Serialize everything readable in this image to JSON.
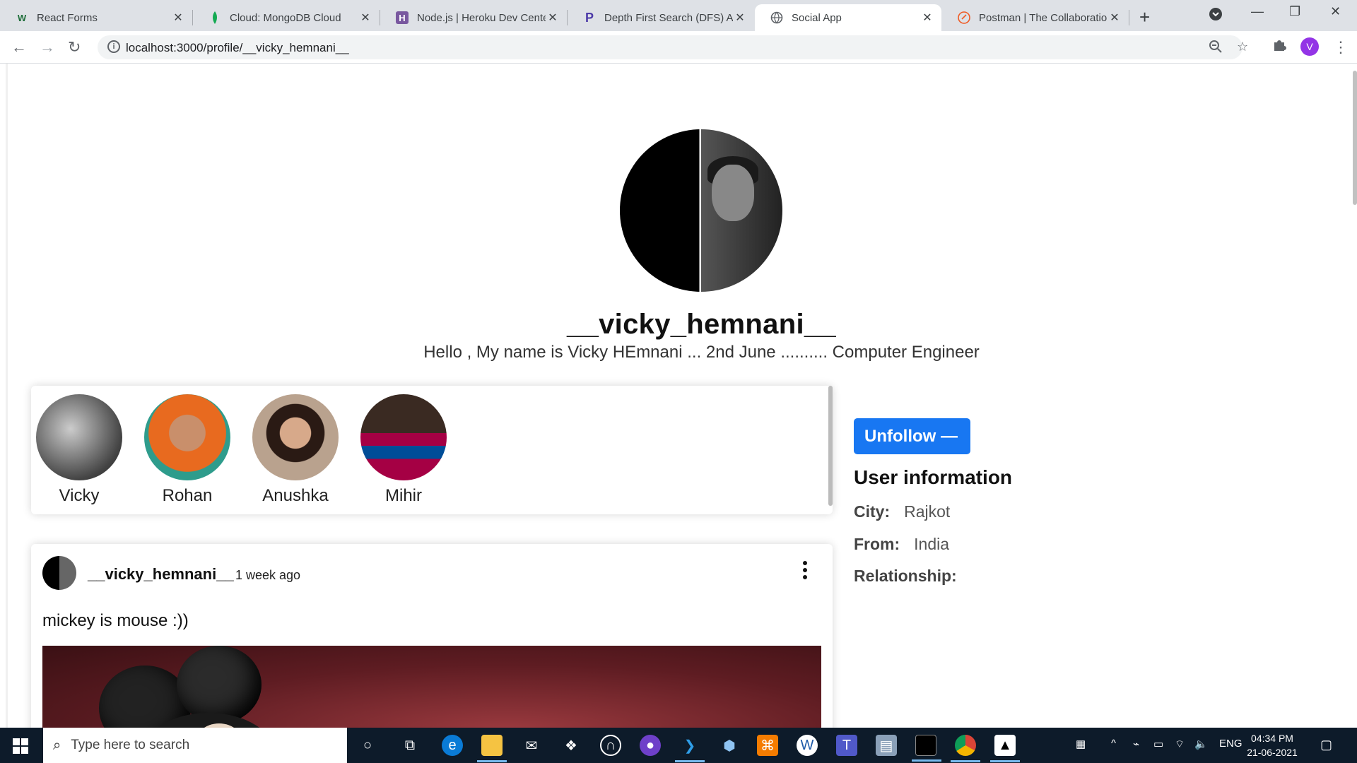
{
  "browser": {
    "tabs": [
      {
        "title": "React Forms",
        "icon": "wix-icon",
        "color": "#1e6e3a"
      },
      {
        "title": "Cloud: MongoDB Cloud",
        "icon": "mongodb-leaf-icon",
        "color": "#13aa52"
      },
      {
        "title": "Node.js | Heroku Dev Cente",
        "icon": "heroku-icon",
        "color": "#79589f"
      },
      {
        "title": "Depth First Search (DFS) Alg",
        "icon": "programiz-icon",
        "color": "#4c3aa8"
      },
      {
        "title": "Social App",
        "icon": "globe-icon",
        "color": "#5f6368"
      },
      {
        "title": "Postman | The Collaboration",
        "icon": "postman-icon",
        "color": "#ef5b25"
      }
    ],
    "active_tab_index": 4,
    "url": "localhost:3000/profile/__vicky_hemnani__",
    "profile_initial": "V"
  },
  "profile": {
    "username": "__vicky_hemnani__",
    "bio": "Hello , My name is Vicky HEmnani ... 2nd June .......... Computer Engineer"
  },
  "friends": [
    {
      "name": "Vicky"
    },
    {
      "name": "Rohan"
    },
    {
      "name": "Anushka"
    },
    {
      "name": "Mihir"
    }
  ],
  "post": {
    "username": "__vicky_hemnani__",
    "time": "1 week ago",
    "text": "mickey is mouse :))"
  },
  "sidebar": {
    "unfollow_label": "Unfollow —",
    "title": "User information",
    "city_label": "City:",
    "city_value": "Rajkot",
    "from_label": "From:",
    "from_value": "India",
    "relationship_label": "Relationship:",
    "relationship_value": ""
  },
  "taskbar": {
    "search_placeholder": "Type here to search",
    "language": "ENG",
    "time": "04:34 PM",
    "date": "21-06-2021"
  },
  "colors": {
    "accent": "#1877f2",
    "taskbar": "#0d1b2a"
  }
}
